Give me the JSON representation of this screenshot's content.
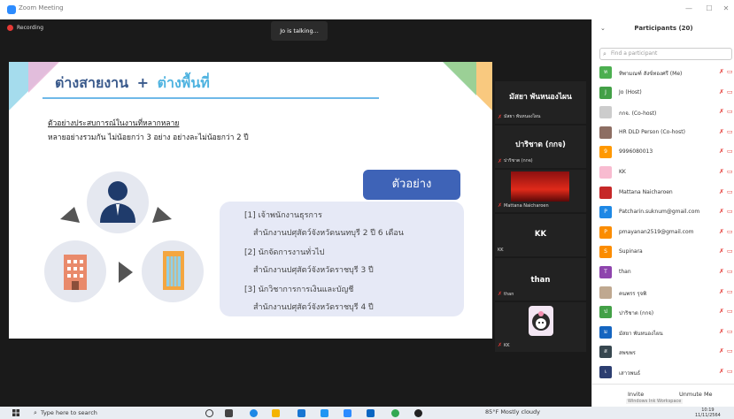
{
  "window": {
    "title": "Zoom Meeting"
  },
  "meeting": {
    "recording_label": "Recording",
    "talking_label": "Jo is talking..."
  },
  "slide": {
    "heading_part1": "ต่างสายงาน",
    "heading_plus": "+",
    "heading_part2": "ต่างพื้นที่",
    "subtitle1": "ตัวอย่างประสบการณ์ในงานที่หลากหลาย",
    "subtitle2": "หลายอย่างรวมกัน ไม่น้อยกว่า 3 อย่าง อย่างละไม่น้อยกว่า 2 ปี",
    "example_label": "ตัวอย่าง",
    "items": [
      "[1] เจ้าพนักงานธุรการ",
      "สำนักงานปศุสัตว์จังหวัดนนทบุรี 2 ปี 6 เดือน",
      "[2] นักจัดการงานทั่วไป",
      "สำนักงานปศุสัตว์จังหวัดราชบุรี 3 ปี",
      "[3] นักวิชาการการเงินและบัญชี",
      "สำนักงานปศุสัตว์จังหวัดราชบุรี 4 ปี"
    ]
  },
  "tiles": [
    {
      "big": "มัสยา พันหนองไผน",
      "small": "มัสยา พันหนองไผน"
    },
    {
      "big": "ปาริชาต (กกจ)",
      "small": "ปาริชาต (กกจ)"
    },
    {
      "big": "",
      "small": "Mattana Naicharoen"
    },
    {
      "big": "KK",
      "small": "KK"
    },
    {
      "big": "than",
      "small": "than"
    },
    {
      "big": "",
      "small": "KK"
    }
  ],
  "panel": {
    "title": "Participants (20)",
    "search_placeholder": "Find a participant",
    "participants": [
      {
        "name": "ทิพามณฑ์ สังข์ทองศรี (Me)",
        "initial": "ท",
        "color": "#4caf50"
      },
      {
        "name": "Jo (Host)",
        "initial": "J",
        "color": "#43a047"
      },
      {
        "name": "กกจ. (Co-host)",
        "initial": "",
        "color": "#cccccc"
      },
      {
        "name": "HR DLD Person (Co-host)",
        "initial": "",
        "color": "#8d6e63"
      },
      {
        "name": "9996080013",
        "initial": "9",
        "color": "#ff9800"
      },
      {
        "name": "KK",
        "initial": "",
        "color": "#f8bbd0"
      },
      {
        "name": "Mattana Naicharoen",
        "initial": "",
        "color": "#c62828"
      },
      {
        "name": "Patcharin.suknum@gmail.com",
        "initial": "P",
        "color": "#1e88e5"
      },
      {
        "name": "pmayanan2519@gmail.com",
        "initial": "P",
        "color": "#fb8c00"
      },
      {
        "name": "Supinara",
        "initial": "S",
        "color": "#fb8c00"
      },
      {
        "name": "than",
        "initial": "T",
        "color": "#8e44ad"
      },
      {
        "name": "คนพรร รุจพิ",
        "initial": "",
        "color": "#bfa890"
      },
      {
        "name": "ปาริชาต (กกจ)",
        "initial": "ป",
        "color": "#43a047"
      },
      {
        "name": "มัสยา พันหนองไผน",
        "initial": "ม",
        "color": "#1565c0"
      },
      {
        "name": "สพขพร",
        "initial": "ส",
        "color": "#37474f"
      },
      {
        "name": "เสาวพนธ์",
        "initial": "เ",
        "color": "#2c3e70"
      }
    ],
    "invite_label": "Invite",
    "unmute_label": "Unmute Me",
    "windows_label": "Windows Ink Workspace"
  },
  "taskbar": {
    "search_placeholder": "Type here to search",
    "weather": "85°F  Mostly cloudy",
    "time": "10:19",
    "date": "11/11/2564"
  }
}
